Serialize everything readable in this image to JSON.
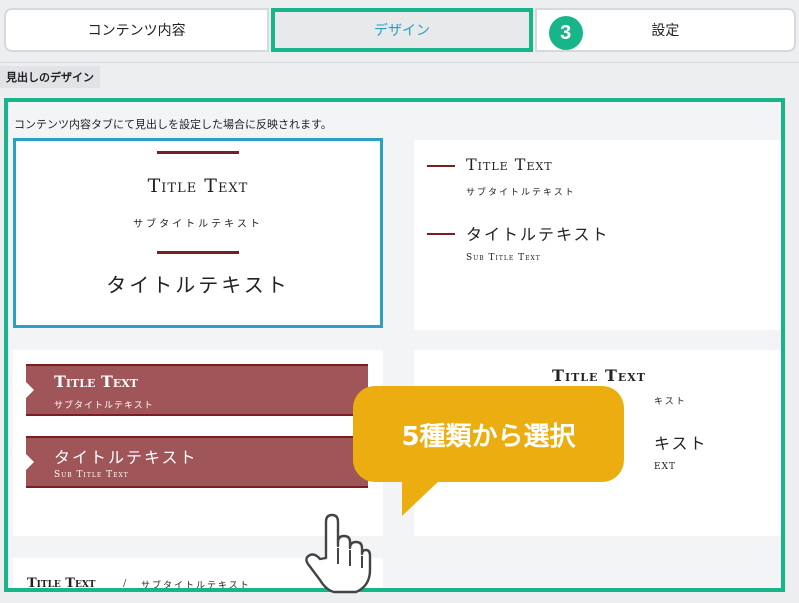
{
  "tabs": [
    {
      "label": "コンテンツ内容"
    },
    {
      "label": "デザイン",
      "active": true
    },
    {
      "label": "設定"
    }
  ],
  "step_badge": "3",
  "section_label": "見出しのデザイン",
  "description": "コンテンツ内容タブにて見出しを設定した場合に反映されます。",
  "cards": [
    {
      "title": "Title Text",
      "subtitle": "サブタイトルテキスト",
      "jp_title": "タイトルテキスト",
      "selected": true
    },
    {
      "title": "Title Text",
      "subtitle": "サブタイトルテキスト",
      "jp_title": "タイトルテキスト",
      "jp_subtitle": "Sub Title Text"
    },
    {
      "title": "Title Text",
      "subtitle": "サブタイトルテキスト",
      "jp_title": "タイトルテキスト",
      "jp_subtitle": "Sub Title Text"
    },
    {
      "title": "Title Text",
      "subtitle": "キスト",
      "jp_title": "キスト",
      "jp_subtitle": "EXT"
    },
    {
      "title": "Title Text",
      "separator": "/",
      "subtitle": "サブタイトルテキスト"
    }
  ],
  "callout": "5種類から選択",
  "colors": {
    "accent_green": "#19b58a",
    "selected_blue": "#2aa0c5",
    "maroon": "#7a1e23",
    "callout_yellow": "#ebad0f"
  },
  "icons": {
    "hand_pointer": "hand-pointer-icon"
  }
}
